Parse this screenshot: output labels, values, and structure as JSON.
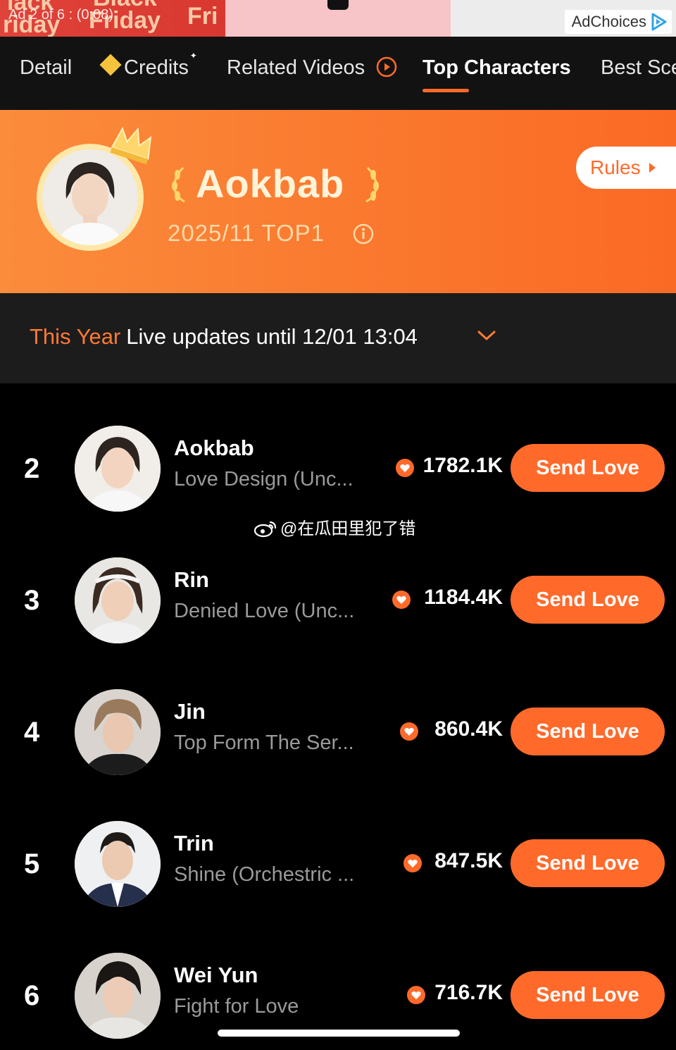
{
  "ad": {
    "counter": "Ad 2 of 6 : (0:08)",
    "words": [
      "lack",
      "Black",
      "riday",
      "Friday",
      "Fri"
    ],
    "adchoices_label": "AdChoices"
  },
  "tabs": {
    "items": [
      {
        "label": "Detail"
      },
      {
        "label": "Credits"
      },
      {
        "label": "Related Videos"
      },
      {
        "label": "Top Characters"
      },
      {
        "label": "Best Sce"
      }
    ],
    "active": "Top Characters"
  },
  "top_character": {
    "name": "Aokbab",
    "subtitle": "2025/11 TOP1",
    "rules_label": "Rules"
  },
  "period": {
    "range": "This Year",
    "live_text": "Live updates until 12/01 13:04"
  },
  "ranking": [
    {
      "rank": "2",
      "name": "Aokbab",
      "show": "Love Design (Unc...",
      "score": "1782.1K",
      "button": "Send Love"
    },
    {
      "rank": "3",
      "name": "Rin",
      "show": "Denied Love (Unc...",
      "score": "1184.4K",
      "button": "Send Love"
    },
    {
      "rank": "4",
      "name": "Jin",
      "show": "Top Form The Ser...",
      "score": "860.4K",
      "button": "Send Love"
    },
    {
      "rank": "5",
      "name": "Trin",
      "show": "Shine (Orchestric ...",
      "score": "847.5K",
      "button": "Send Love"
    },
    {
      "rank": "6",
      "name": "Wei Yun",
      "show": "Fight for Love",
      "score": "716.7K",
      "button": "Send Love"
    }
  ],
  "watermark": "@在瓜田里犯了错",
  "colors": {
    "accent": "#ff6a2b",
    "banner_gold": "#fff3d8",
    "muted_text": "#9a9a9a"
  }
}
